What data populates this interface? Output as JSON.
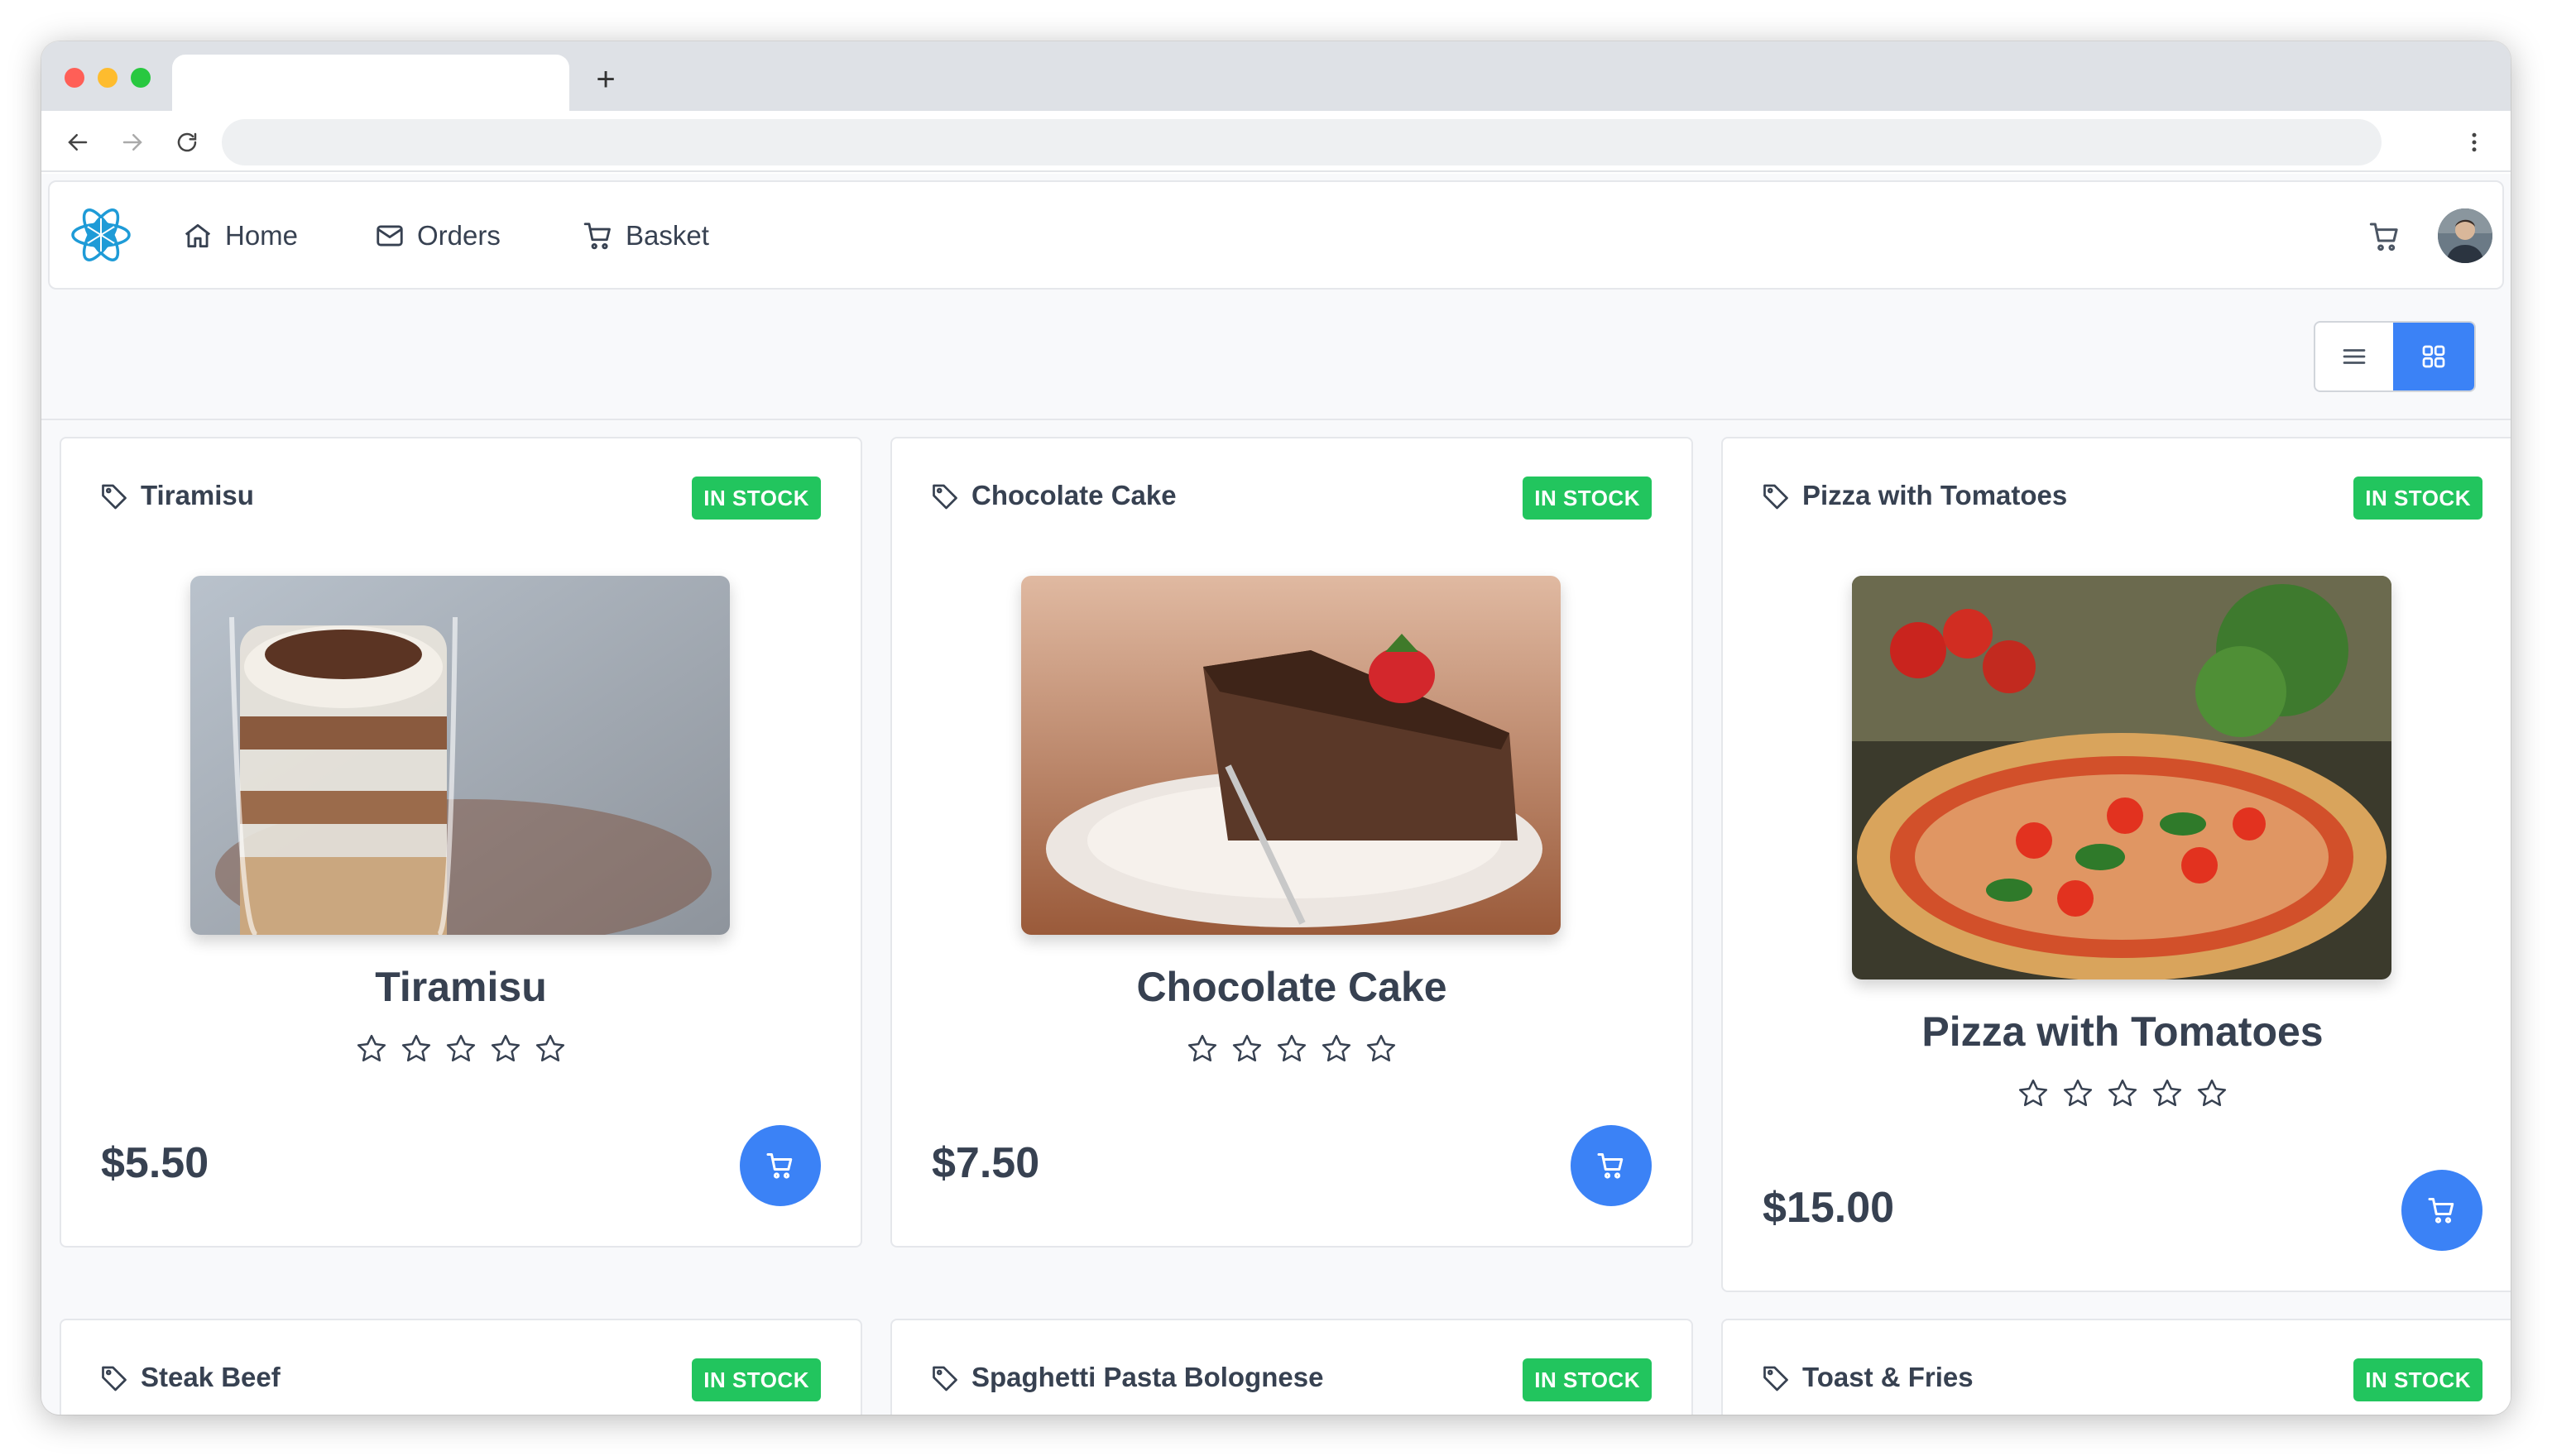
{
  "browser": {
    "new_tab_symbol": "+",
    "icons": [
      "back-arrow-icon",
      "forward-arrow-icon",
      "reload-icon",
      "more-vertical-icon"
    ]
  },
  "nav": {
    "items": [
      {
        "label": "Home",
        "icon": "home-icon"
      },
      {
        "label": "Orders",
        "icon": "envelope-icon"
      },
      {
        "label": "Basket",
        "icon": "cart-icon"
      }
    ],
    "logo_color": "#1e9bd7"
  },
  "view_toggle": {
    "options": [
      "list",
      "grid"
    ],
    "selected": "grid"
  },
  "products": [
    {
      "category": "Tiramisu",
      "stock": "IN STOCK",
      "name": "Tiramisu",
      "rating": 0,
      "price": "$5.50"
    },
    {
      "category": "Chocolate Cake",
      "stock": "IN STOCK",
      "name": "Chocolate Cake",
      "rating": 0,
      "price": "$7.50"
    },
    {
      "category": "Pizza with Tomatoes",
      "stock": "IN STOCK",
      "name": "Pizza with Tomatoes",
      "rating": 0,
      "price": "$15.00"
    },
    {
      "category": "Steak Beef",
      "stock": "IN STOCK"
    },
    {
      "category": "Spaghetti Pasta Bolognese",
      "stock": "IN STOCK"
    },
    {
      "category": "Toast & Fries",
      "stock": "IN STOCK"
    }
  ],
  "colors": {
    "accent": "#3b82f6",
    "in_stock": "#22c55e",
    "text": "#374151"
  }
}
